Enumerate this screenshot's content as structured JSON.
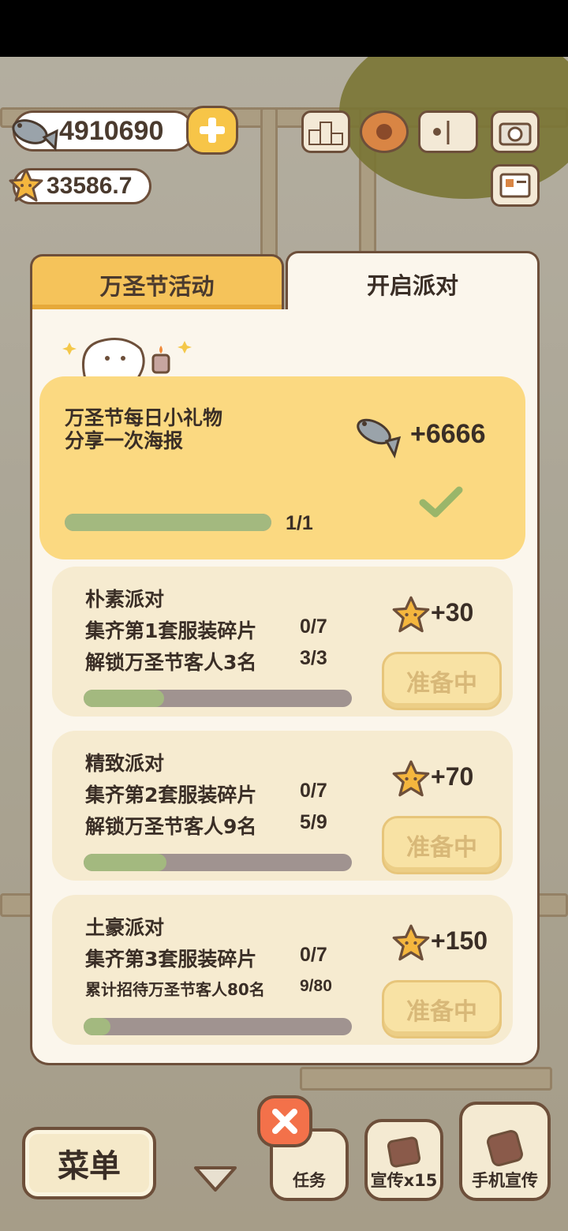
{
  "hud": {
    "fish_count": "4910690",
    "star_count": "33586.7",
    "icons": [
      "fish-icon",
      "star-icon",
      "plus-icon",
      "ranking-icon",
      "gear-icon",
      "album-icon",
      "camera-icon",
      "profile-card-icon"
    ]
  },
  "tabs": [
    {
      "label": "万圣节活动",
      "active": false
    },
    {
      "label": "开启派对",
      "active": true
    }
  ],
  "daily_gift": {
    "title_line1": "万圣节每日小礼物",
    "title_line2": "分享一次海报",
    "reward": "+6666",
    "progress_text": "1/1",
    "progress": 1.0,
    "completed": true
  },
  "parties": [
    {
      "name": "朴素派对",
      "req1": "集齐第1套服装碎片",
      "req1_count": "0/7",
      "req2": "解锁万圣节客人3名",
      "req2_count": "3/3",
      "reward": "+30",
      "progress": 0.3,
      "button": "准备中"
    },
    {
      "name": "精致派对",
      "req1": "集齐第2套服装碎片",
      "req1_count": "0/7",
      "req2": "解锁万圣节客人9名",
      "req2_count": "5/9",
      "reward": "+70",
      "progress": 0.31,
      "button": "准备中"
    },
    {
      "name": "土豪派对",
      "req1": "集齐第3套服装碎片",
      "req1_count": "0/7",
      "req2": "累计招待万圣节客人80名",
      "req2_count": "9/80",
      "reward": "+150",
      "progress": 0.1,
      "button": "准备中"
    }
  ],
  "bottom": {
    "menu": "菜单",
    "tasks": "任务",
    "promote": "宣传x15",
    "phone_promote": "手机宣传"
  },
  "colors": {
    "panel_bg": "#fbf6ec",
    "active_tab": "#fbf6ec",
    "inactive_tab": "#f5c35a",
    "highlight_card": "#fbd981",
    "card_bg": "#f6ebd0",
    "progress_fill": "#a3b97f",
    "progress_track": "#a09390",
    "button_disabled": "#f8e2a4",
    "close_button": "#f3714a",
    "outline": "#6d4f3a"
  }
}
